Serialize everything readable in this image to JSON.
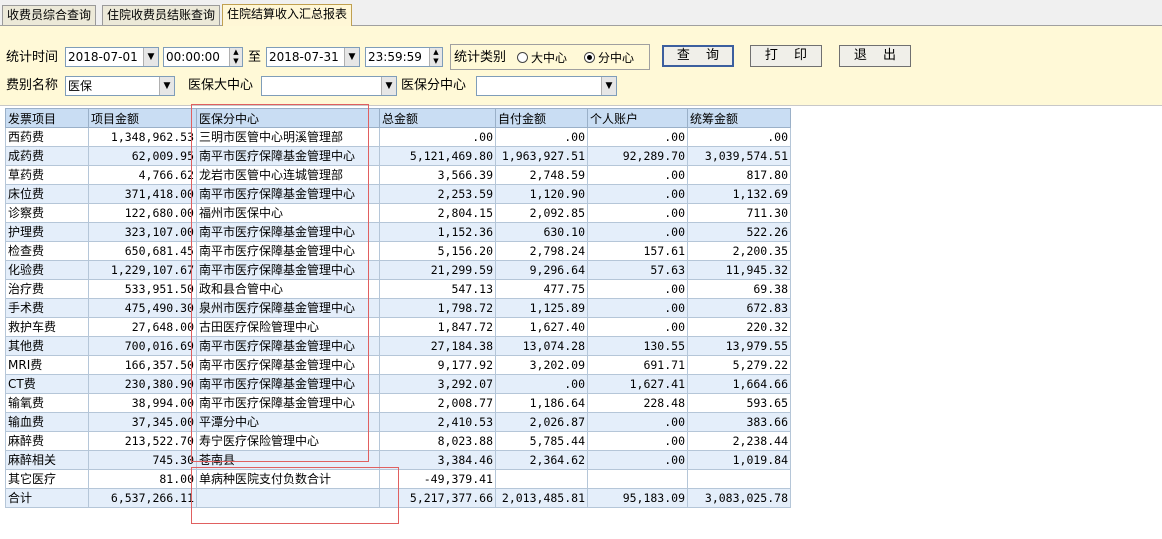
{
  "tabs": [
    {
      "label": "收费员综合查询",
      "active": false
    },
    {
      "label": "住院收费员结账查询",
      "active": false
    },
    {
      "label": "住院结算收入汇总报表",
      "active": true
    }
  ],
  "filters": {
    "time_label": "统计时间",
    "start_date": "2018-07-01",
    "start_time": "00:00:00",
    "to_label": "至",
    "end_date": "2018-07-31",
    "end_time": "23:59:59",
    "category_label": "统计类别",
    "radio_big": "大中心",
    "radio_branch": "分中心",
    "selected_category": "分中心",
    "fee_type_label": "费别名称",
    "fee_type_value": "医保",
    "center_label": "医保大中心",
    "center_value": "",
    "branch_label": "医保分中心",
    "branch_value": ""
  },
  "buttons": {
    "query": "查 询",
    "print": "打 印",
    "exit": "退 出"
  },
  "table": {
    "columns": [
      "发票项目",
      "项目金额",
      "医保分中心",
      "总金额",
      "自付金额",
      "个人账户",
      "统筹金额"
    ],
    "rows": [
      [
        "西药费",
        "1,348,962.53",
        "三明市医管中心明溪管理部",
        ".00",
        ".00",
        ".00",
        ".00"
      ],
      [
        "成药费",
        "62,009.95",
        "南平市医疗保障基金管理中心",
        "5,121,469.80",
        "1,963,927.51",
        "92,289.70",
        "3,039,574.51"
      ],
      [
        "草药费",
        "4,766.62",
        "龙岩市医管中心连城管理部",
        "3,566.39",
        "2,748.59",
        ".00",
        "817.80"
      ],
      [
        "床位费",
        "371,418.00",
        "南平市医疗保障基金管理中心",
        "2,253.59",
        "1,120.90",
        ".00",
        "1,132.69"
      ],
      [
        "诊察费",
        "122,680.00",
        "福州市医保中心",
        "2,804.15",
        "2,092.85",
        ".00",
        "711.30"
      ],
      [
        "护理费",
        "323,107.00",
        "南平市医疗保障基金管理中心",
        "1,152.36",
        "630.10",
        ".00",
        "522.26"
      ],
      [
        "检查费",
        "650,681.45",
        "南平市医疗保障基金管理中心",
        "5,156.20",
        "2,798.24",
        "157.61",
        "2,200.35"
      ],
      [
        "化验费",
        "1,229,107.67",
        "南平市医疗保障基金管理中心",
        "21,299.59",
        "9,296.64",
        "57.63",
        "11,945.32"
      ],
      [
        "治疗费",
        "533,951.50",
        "政和县合管中心",
        "547.13",
        "477.75",
        ".00",
        "69.38"
      ],
      [
        "手术费",
        "475,490.30",
        "泉州市医疗保障基金管理中心",
        "1,798.72",
        "1,125.89",
        ".00",
        "672.83"
      ],
      [
        "救护车费",
        "27,648.00",
        "古田医疗保险管理中心",
        "1,847.72",
        "1,627.40",
        ".00",
        "220.32"
      ],
      [
        "其他费",
        "700,016.69",
        "南平市医疗保障基金管理中心",
        "27,184.38",
        "13,074.28",
        "130.55",
        "13,979.55"
      ],
      [
        "MRI费",
        "166,357.50",
        "南平市医疗保障基金管理中心",
        "9,177.92",
        "3,202.09",
        "691.71",
        "5,279.22"
      ],
      [
        "CT费",
        "230,380.90",
        "南平市医疗保障基金管理中心",
        "3,292.07",
        ".00",
        "1,627.41",
        "1,664.66"
      ],
      [
        "输氧费",
        "38,994.00",
        "南平市医疗保障基金管理中心",
        "2,008.77",
        "1,186.64",
        "228.48",
        "593.65"
      ],
      [
        "输血费",
        "37,345.00",
        "平潭分中心",
        "2,410.53",
        "2,026.87",
        ".00",
        "383.66"
      ],
      [
        "麻醉费",
        "213,522.70",
        "寿宁医疗保险管理中心",
        "8,023.88",
        "5,785.44",
        ".00",
        "2,238.44"
      ],
      [
        "麻醉相关",
        "745.30",
        "苍南县",
        "3,384.46",
        "2,364.62",
        ".00",
        "1,019.84"
      ],
      [
        "其它医疗",
        "81.00",
        "单病种医院支付负数合计",
        "-49,379.41",
        "",
        "",
        ""
      ],
      [
        "合计",
        "6,537,266.11",
        "",
        "5,217,377.66",
        "2,013,485.81",
        "95,183.09",
        "3,083,025.78"
      ]
    ]
  }
}
